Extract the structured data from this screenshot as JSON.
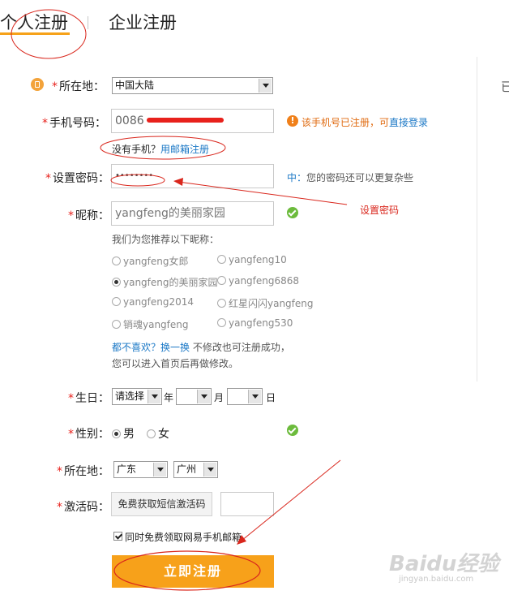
{
  "tabs": {
    "personal": "个人注册",
    "company": "企业注册"
  },
  "right_partial": "已",
  "form": {
    "region": {
      "label": "所在地：",
      "value": "中国大陆"
    },
    "phone": {
      "label": "手机号码：",
      "value": "0086",
      "status": "该手机号已注册，可",
      "status_link": "直接登录"
    },
    "no_phone": {
      "text": "没有手机？",
      "link": "用邮箱注册"
    },
    "password": {
      "label": "设置密码：",
      "value": "••••••••",
      "strength_label": "中：",
      "strength_text": "您的密码还可以更复杂些"
    },
    "nickname": {
      "label": "昵称：",
      "value": "yangfeng的美丽家园",
      "suggest_title": "我们为您推荐以下昵称：",
      "options": [
        "yangfeng女郎",
        "yangfeng10",
        "yangfeng的美丽家园",
        "yangfeng6868",
        "yangfeng2014",
        "红星闪闪yangfeng",
        "销魂yangfeng",
        "yangfeng530"
      ],
      "selected_index": 2,
      "change_link": "都不喜欢？换一换",
      "change_note": " 不修改也可注册成功，",
      "change_note2": "您可以进入首页后再做修改。"
    },
    "birthday": {
      "label": "生日：",
      "year_value": "请选择",
      "year_unit": "年",
      "month_value": "",
      "month_unit": "月",
      "day_value": "",
      "day_unit": "日"
    },
    "gender": {
      "label": "性别：",
      "male": "男",
      "female": "女",
      "selected": "男"
    },
    "location": {
      "label": "所在地：",
      "province": "广东",
      "city": "广州"
    },
    "activation": {
      "label": "激活码：",
      "button": "免费获取短信激活码",
      "value": ""
    },
    "mailbox_checkbox": {
      "label": "同时免费领取网易手机邮箱",
      "checked": true
    },
    "submit": "立即注册"
  },
  "annotation": {
    "label": "设置密码"
  },
  "watermark": {
    "brand": "Baidu经验",
    "url": "jingyan.baidu.com"
  },
  "colors": {
    "accent": "#f7a11a",
    "required": "#e8211c",
    "link": "#1b78c6",
    "success": "#6cbb3c",
    "annotation": "#d9261c"
  }
}
